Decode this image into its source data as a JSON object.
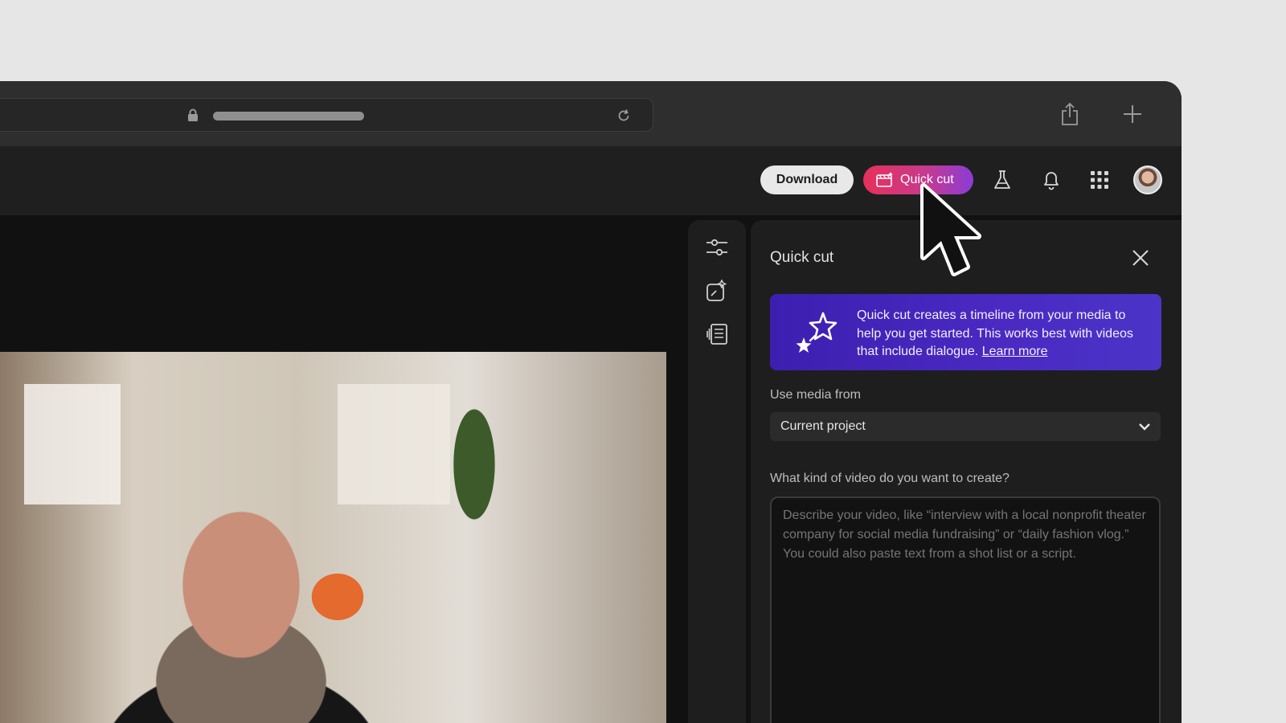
{
  "header": {
    "download_label": "Download",
    "quickcut_label": "Quick cut"
  },
  "icons": {
    "lock": "lock-icon",
    "reload": "reload-icon",
    "share": "share-icon",
    "new_tab": "plus-icon",
    "labs": "flask-icon",
    "notifications": "bell-icon",
    "apps": "grid-icon",
    "rail": [
      "sliders-icon",
      "sparkle-edit-icon",
      "transcript-icon"
    ]
  },
  "panel": {
    "title": "Quick cut",
    "banner": {
      "text": "Quick cut creates a timeline from your media to help you get started. This works best with videos that include dialogue.",
      "link": "Learn more"
    },
    "media_label": "Use media from",
    "media_value": "Current project",
    "prompt_label": "What kind of video do you want to create?",
    "prompt_placeholder": "Describe your video, like “interview with a local nonprofit theater company for social media fundraising” or “daily fashion vlog.” You could also paste text from a shot list or a script."
  },
  "colors": {
    "accent_gradient_start": "#e6305a",
    "accent_gradient_end": "#8a3cd6",
    "banner": "#4127b8"
  }
}
